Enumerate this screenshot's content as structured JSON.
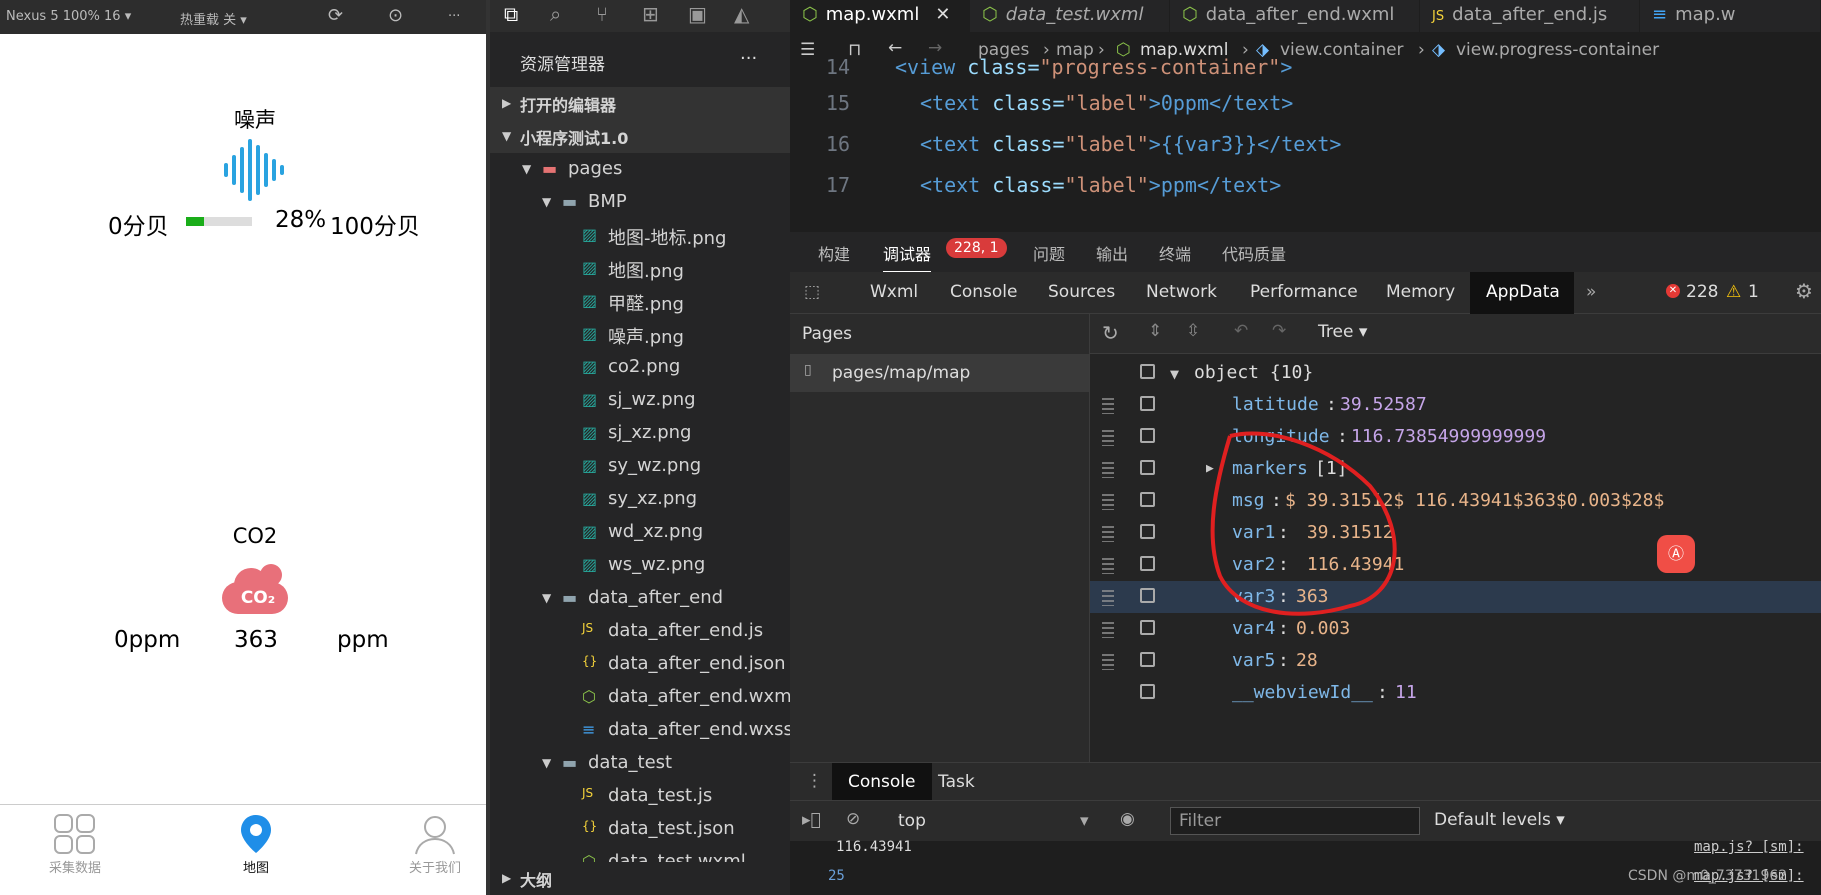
{
  "simulator": {
    "device": "Nexus 5 100% 16 ▾",
    "hotreload": "热重载 关 ▾",
    "noise": {
      "title": "噪声",
      "left": "0分贝",
      "progress_label": "28%",
      "right": "100分贝",
      "progress": 0.28
    },
    "co2": {
      "title": "CO2",
      "left": "0ppm",
      "value": "363",
      "unit": "ppm",
      "icon_text": "CO₂"
    },
    "tabs": [
      {
        "label": "采集数据"
      },
      {
        "label": "地图"
      },
      {
        "label": "关于我们"
      }
    ]
  },
  "explorer": {
    "title": "资源管理器",
    "menu": "···",
    "open_editors": "打开的编辑器",
    "project": "小程序测试1.0",
    "items": [
      {
        "label": "pages"
      },
      {
        "label": "BMP"
      },
      {
        "label": "地图-地标.png"
      },
      {
        "label": "地图.png"
      },
      {
        "label": "甲醛.png"
      },
      {
        "label": "噪声.png"
      },
      {
        "label": "co2.png"
      },
      {
        "label": "sj_wz.png"
      },
      {
        "label": "sj_xz.png"
      },
      {
        "label": "sy_wz.png"
      },
      {
        "label": "sy_xz.png"
      },
      {
        "label": "wd_xz.png"
      },
      {
        "label": "ws_wz.png"
      },
      {
        "label": "data_after_end"
      },
      {
        "label": "data_after_end.js"
      },
      {
        "label": "data_after_end.json"
      },
      {
        "label": "data_after_end.wxml"
      },
      {
        "label": "data_after_end.wxss"
      },
      {
        "label": "data_test"
      },
      {
        "label": "data_test.js"
      },
      {
        "label": "data_test.json"
      },
      {
        "label": "data_test.wxml"
      }
    ],
    "outline": "大纲"
  },
  "editor": {
    "tabs": [
      {
        "label": "map.wxml"
      },
      {
        "label": "data_test.wxml"
      },
      {
        "label": "data_after_end.wxml"
      },
      {
        "label": "data_after_end.js"
      },
      {
        "label": "map.w"
      }
    ],
    "breadcrumb": [
      "pages",
      "map",
      "map.wxml",
      "view.container",
      "view.progress-container"
    ],
    "lines": [
      {
        "n": "14",
        "a": "<view ",
        "b": "class=",
        "c": "\"progress-container\"",
        "d": ">"
      },
      {
        "n": "15",
        "a": "<text ",
        "b": "class=",
        "c": "\"label\"",
        "d": ">0ppm</text>"
      },
      {
        "n": "16",
        "a": "<text ",
        "b": "class=",
        "c": "\"label\"",
        "d": ">{{var3}}</text>"
      },
      {
        "n": "17",
        "a": "<text ",
        "b": "class=",
        "c": "\"label\"",
        "d": ">ppm</text>"
      }
    ]
  },
  "panel": {
    "tabs": [
      "构建",
      "调试器",
      "问题",
      "输出",
      "终端",
      "代码质量"
    ],
    "badge": "228, 1",
    "devtools": [
      "Wxml",
      "Console",
      "Sources",
      "Network",
      "Performance",
      "Memory",
      "AppData"
    ],
    "errors": "228",
    "warnings": "1",
    "tree_mode": "Tree ▾",
    "pages_title": "Pages",
    "page_item": "pages/map/map",
    "root": "object {10}",
    "rows": [
      {
        "k": "latitude",
        "v": "39.52587"
      },
      {
        "k": "longitude",
        "v": "116.73854999999999"
      },
      {
        "k": "markers",
        "v": "[1]"
      },
      {
        "k": "msg",
        "v": "$ 39.31512$ 116.43941$363$0.003$28$"
      },
      {
        "k": "var1",
        "v": " 39.31512"
      },
      {
        "k": "var2",
        "v": " 116.43941"
      },
      {
        "k": "var3",
        "v": "363"
      },
      {
        "k": "var4",
        "v": "0.003"
      },
      {
        "k": "var5",
        "v": "28"
      },
      {
        "k": "__webviewId__",
        "v": "11"
      }
    ]
  },
  "console": {
    "tab1": "Console",
    "tab2": "Task",
    "context": "top",
    "filter": "Filter",
    "levels": "Default levels ▾",
    "out1": "116.43941",
    "out1_src": "map.js? [sm]:",
    "line": "25",
    "out2_src": "map.js? [sm]:",
    "watermark": "CSDN @m0_73731962"
  },
  "colors": {
    "accent": "#1aad19",
    "red_circle": "#e02020"
  }
}
